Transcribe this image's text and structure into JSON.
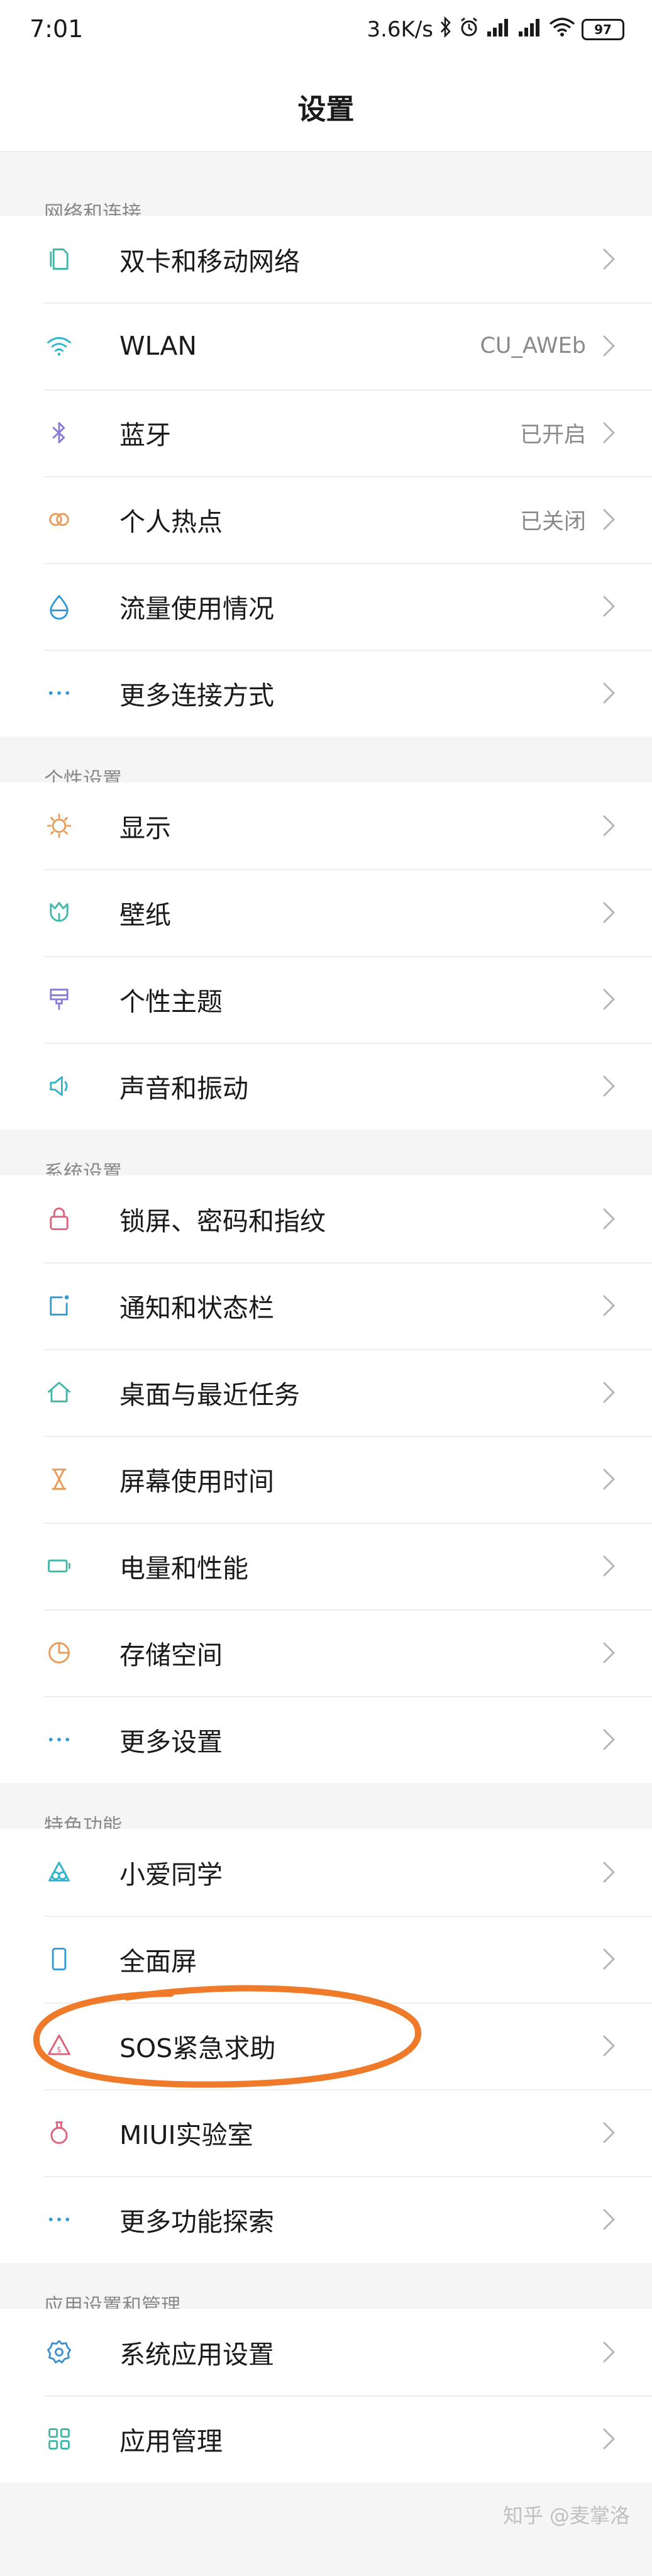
{
  "status_bar": {
    "time": "7:01",
    "net_speed": "3.6K/s",
    "battery": "97"
  },
  "header": {
    "title": "设置"
  },
  "sections": [
    {
      "title": "网络和连接",
      "items": [
        {
          "label": "双卡和移动网络",
          "value": "",
          "icon": "sim-card-icon",
          "color": "#3fb7a5"
        },
        {
          "label": "WLAN",
          "value": "CU_AWEb",
          "icon": "wifi-icon",
          "color": "#30b4c9"
        },
        {
          "label": "蓝牙",
          "value": "已开启",
          "icon": "bluetooth-icon",
          "color": "#8b7bd9"
        },
        {
          "label": "个人热点",
          "value": "已关闭",
          "icon": "hotspot-icon",
          "color": "#eb9a55"
        },
        {
          "label": "流量使用情况",
          "value": "",
          "icon": "data-usage-icon",
          "color": "#2f9ad6"
        },
        {
          "label": "更多连接方式",
          "value": "",
          "icon": "more-dots-icon",
          "color": "#2f9ad6"
        }
      ]
    },
    {
      "title": "个性设置",
      "items": [
        {
          "label": "显示",
          "value": "",
          "icon": "display-sun-icon",
          "color": "#eb9a55"
        },
        {
          "label": "壁纸",
          "value": "",
          "icon": "wallpaper-tulip-icon",
          "color": "#3fb7a5"
        },
        {
          "label": "个性主题",
          "value": "",
          "icon": "theme-brush-icon",
          "color": "#8b7bd9"
        },
        {
          "label": "声音和振动",
          "value": "",
          "icon": "speaker-icon",
          "color": "#30b4c9"
        }
      ]
    },
    {
      "title": "系统设置",
      "items": [
        {
          "label": "锁屏、密码和指纹",
          "value": "",
          "icon": "lock-icon",
          "color": "#e0607a"
        },
        {
          "label": "通知和状态栏",
          "value": "",
          "icon": "notification-icon",
          "color": "#2f9ad6"
        },
        {
          "label": "桌面与最近任务",
          "value": "",
          "icon": "home-icon",
          "color": "#3fb7a5"
        },
        {
          "label": "屏幕使用时间",
          "value": "",
          "icon": "hourglass-icon",
          "color": "#eb9a55"
        },
        {
          "label": "电量和性能",
          "value": "",
          "icon": "battery-icon",
          "color": "#3fb7a5"
        },
        {
          "label": "存储空间",
          "value": "",
          "icon": "storage-pie-icon",
          "color": "#eb9a55"
        },
        {
          "label": "更多设置",
          "value": "",
          "icon": "more-dots-icon",
          "color": "#2f9ad6"
        }
      ]
    },
    {
      "title": "特色功能",
      "items": [
        {
          "label": "小爱同学",
          "value": "",
          "icon": "xiaoai-icon",
          "color": "#30b4c9"
        },
        {
          "label": "全面屏",
          "value": "",
          "icon": "fullscreen-phone-icon",
          "color": "#2f9ad6"
        },
        {
          "label": "SOS紧急求助",
          "value": "",
          "icon": "sos-icon",
          "color": "#e0607a"
        },
        {
          "label": "MIUI实验室",
          "value": "",
          "icon": "lab-flask-icon",
          "color": "#e0607a"
        },
        {
          "label": "更多功能探索",
          "value": "",
          "icon": "more-dots-icon",
          "color": "#2f9ad6"
        }
      ]
    },
    {
      "title": "应用设置和管理",
      "items": [
        {
          "label": "系统应用设置",
          "value": "",
          "icon": "gear-icon",
          "color": "#3a8fd0"
        },
        {
          "label": "应用管理",
          "value": "",
          "icon": "app-grid-icon",
          "color": "#3fb7a5"
        }
      ]
    }
  ],
  "watermark": "知乎 @麦掌洛"
}
